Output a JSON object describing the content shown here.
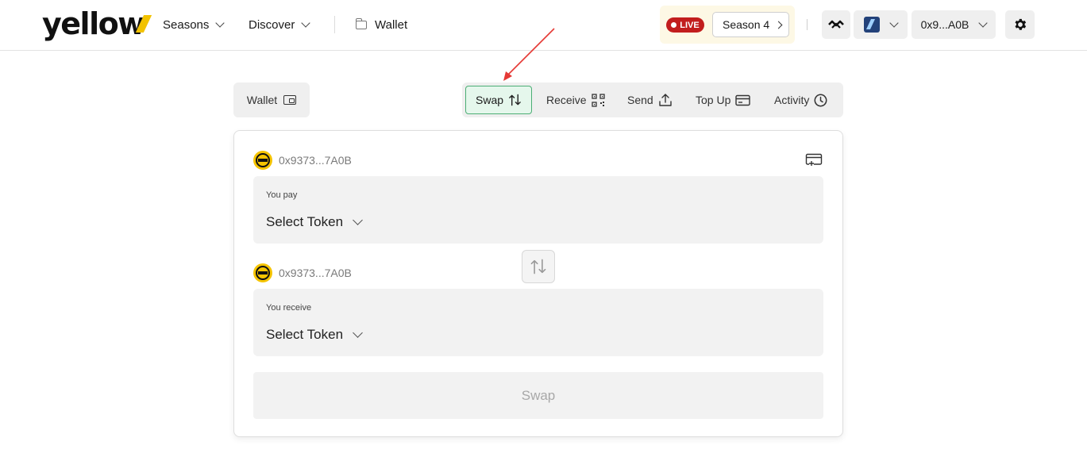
{
  "header": {
    "logo": "yellow",
    "nav": {
      "seasons": "Seasons",
      "discover": "Discover"
    },
    "breadcrumb": "Wallet",
    "live_badge": "LIVE",
    "season_button": "Season 4",
    "account": "0x9...A0B"
  },
  "subnav": {
    "wallet": "Wallet",
    "tabs": [
      {
        "label": "Swap",
        "icon": "swap-arrows-icon",
        "active": true
      },
      {
        "label": "Receive",
        "icon": "qr-code-icon"
      },
      {
        "label": "Send",
        "icon": "upload-icon"
      },
      {
        "label": "Top Up",
        "icon": "card-icon"
      },
      {
        "label": "Activity",
        "icon": "clock-icon"
      }
    ]
  },
  "swap_card": {
    "from_address": "0x9373...7A0B",
    "pay_label": "You pay",
    "pay_token": "Select Token",
    "to_address": "0x9373...7A0B",
    "receive_label": "You receive",
    "receive_token": "Select Token",
    "submit": "Swap"
  },
  "colors": {
    "brand_yellow": "#f5c400",
    "live_red": "#c21d1d",
    "active_green": "#4cae75",
    "arrow_red": "#e53935"
  }
}
